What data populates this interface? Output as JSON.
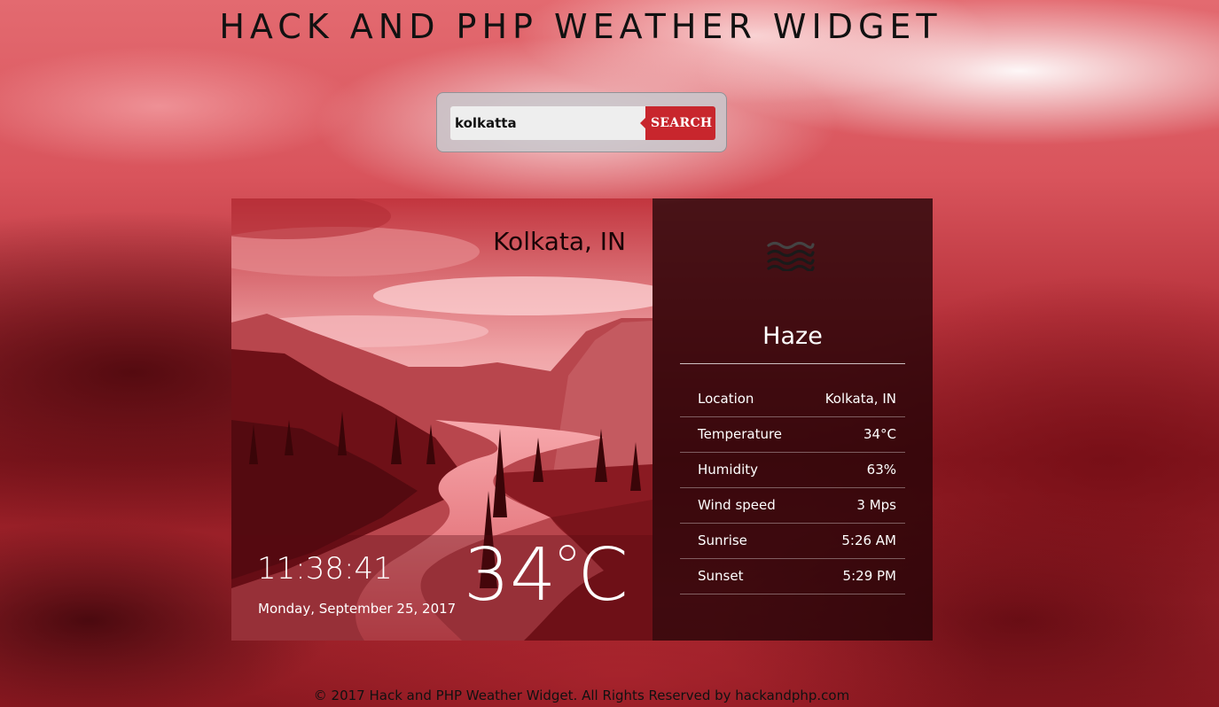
{
  "page": {
    "title": "HACK AND PHP WEATHER WIDGET"
  },
  "search": {
    "value": "kolkatta",
    "button_label": "SEARCH"
  },
  "current": {
    "city": "Kolkata, IN",
    "time": "11:38:41",
    "date": "Monday, September 25, 2017",
    "temp_value": "34",
    "temp_unit": "C"
  },
  "details": {
    "icon": "haze-icon",
    "condition": "Haze",
    "rows": [
      {
        "label": "Location",
        "value": "Kolkata, IN"
      },
      {
        "label": "Temperature",
        "value": "34°C"
      },
      {
        "label": "Humidity",
        "value": "63%"
      },
      {
        "label": "Wind speed",
        "value": "3 Mps"
      },
      {
        "label": "Sunrise",
        "value": "5:26 AM"
      },
      {
        "label": "Sunset",
        "value": "5:29 PM"
      }
    ]
  },
  "footer": {
    "text": "© 2017 Hack and PHP Weather Widget. All Rights Reserved by hackandphp.com"
  },
  "colors": {
    "accent": "#c8262d",
    "panel": "#260408"
  }
}
